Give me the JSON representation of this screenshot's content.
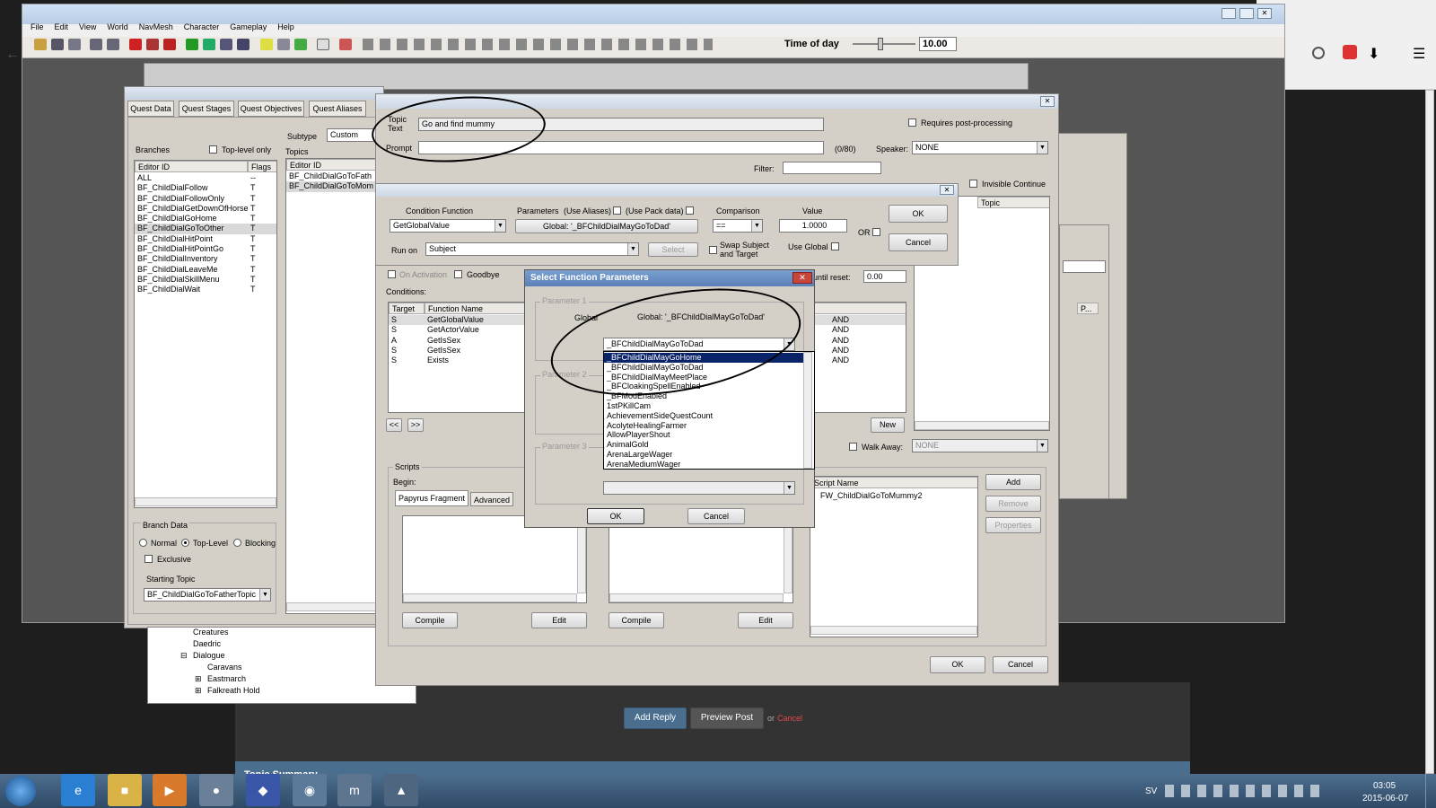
{
  "editor": {
    "menu": [
      "File",
      "Edit",
      "View",
      "World",
      "NavMesh",
      "Character",
      "Gameplay",
      "Help"
    ],
    "time_of_day_label": "Time of day",
    "time_of_day_value": "10.00"
  },
  "quest_window": {
    "tabs": [
      "Quest Data",
      "Quest Stages",
      "Quest Objectives",
      "Quest Aliases"
    ],
    "subtype_label": "Subtype",
    "subtype_value": "Custom",
    "branches_label": "Branches",
    "top_level_only_label": "Top-level only",
    "topics_label": "Topics",
    "branch_col_editor": "Editor ID",
    "branch_col_flags": "Flags",
    "branches": [
      {
        "id": "ALL",
        "flag": "--"
      },
      {
        "id": "BF_ChildDialFollow",
        "flag": "T"
      },
      {
        "id": "BF_ChildDialFollowOnly",
        "flag": "T"
      },
      {
        "id": "BF_ChildDialGetDownOfHorse",
        "flag": "T"
      },
      {
        "id": "BF_ChildDialGoHome",
        "flag": "T"
      },
      {
        "id": "BF_ChildDialGoToOther",
        "flag": "T"
      },
      {
        "id": "BF_ChildDialHitPoint",
        "flag": "T"
      },
      {
        "id": "BF_ChildDialHitPointGo",
        "flag": "T"
      },
      {
        "id": "BF_ChildDialInventory",
        "flag": "T"
      },
      {
        "id": "BF_ChildDialLeaveMe",
        "flag": "T"
      },
      {
        "id": "BF_ChildDialSkillMenu",
        "flag": "T"
      },
      {
        "id": "BF_ChildDialWait",
        "flag": "T"
      }
    ],
    "topics_col_editor": "Editor ID",
    "topics": [
      "BF_ChildDialGoToFath",
      "BF_ChildDialGoToMom"
    ],
    "branch_data_label": "Branch Data",
    "radio_normal": "Normal",
    "radio_top_level": "Top-Level",
    "radio_blocking": "Blocking",
    "exclusive_label": "Exclusive",
    "starting_topic_label": "Starting Topic",
    "starting_topic_value": "BF_ChildDialGoToFatherTopic"
  },
  "object_tree": [
    "Creatures",
    "Daedric",
    "Dialogue",
    "Caravans",
    "Eastmarch",
    "Falkreath Hold"
  ],
  "topic_info": {
    "topic_text_label": "Topic\nText",
    "topic_text_value": "Go and find mummy",
    "requires_post_label": "Requires post-processing",
    "prompt_label": "Prompt",
    "prompt_count": "(0/80)",
    "speaker_label": "Speaker:",
    "speaker_value": "NONE",
    "filter_label": "Filter:",
    "invisible_continue_label": "Invisible Continue",
    "topic_col": "Topic",
    "on_activation_label": "On Activation",
    "goodbye_label": "Goodbye",
    "until_reset_label": "until reset:",
    "until_reset_value": "0.00",
    "conditions_label": "Conditions:",
    "cond_col_target": "Target",
    "cond_col_function": "Function Name",
    "conditions": [
      {
        "target": "S",
        "func": "GetGlobalValue",
        "op": "AND"
      },
      {
        "target": "S",
        "func": "GetActorValue",
        "op": "AND"
      },
      {
        "target": "A",
        "func": "GetIsSex",
        "op": "AND"
      },
      {
        "target": "S",
        "func": "GetIsSex",
        "op": "AND"
      },
      {
        "target": "S",
        "func": "Exists",
        "op": "AND"
      }
    ],
    "prev_btn": "<<",
    "next_btn": ">>",
    "new_btn": "New",
    "walk_away_label": "Walk Away:",
    "walk_away_value": "NONE",
    "scripts_label": "Scripts",
    "begin_label": "Begin:",
    "papyrus_tab": "Papyrus Fragment",
    "advanced_tab": "Advanced",
    "compile_btn": "Compile",
    "edit_btn": "Edit",
    "script_name_col": "Script Name",
    "script_name": "FW_ChildDialGoToMummy2",
    "add_btn": "Add",
    "remove_btn": "Remove",
    "properties_btn": "Properties",
    "ok_btn": "OK",
    "cancel_btn": "Cancel",
    "p_col": "P..."
  },
  "condition_dialog": {
    "condition_function_label": "Condition Function",
    "function_value": "GetGlobalValue",
    "parameters_label": "Parameters",
    "use_aliases_label": "(Use Aliases)",
    "use_pack_label": "(Use Pack data)",
    "global_param": "Global: '_BFChildDialMayGoToDad'",
    "comparison_label": "Comparison",
    "comparison_value": "==",
    "value_label": "Value",
    "value_value": "1.0000",
    "or_label": "OR",
    "run_on_label": "Run on",
    "run_on_value": "Subject",
    "select_btn": "Select",
    "swap_label": "Swap Subject\nand Target",
    "use_global_label": "Use Global",
    "ok_btn": "OK",
    "cancel_btn": "Cancel"
  },
  "select_params": {
    "title": "Select Function Parameters",
    "group1": "Parameter 1",
    "group2": "Parameter 2",
    "group3": "Parameter 3",
    "global_label": "Global",
    "global_current": "Global: '_BFChildDialMayGoToDad'",
    "combo_value": "_BFChildDialMayGoToDad",
    "options": [
      "_BFChildDialMayGoHome",
      "_BFChildDialMayGoToDad",
      "_BFChildDialMayMeetPlace",
      "_BFCloakingSpellEnabled",
      "_BFModEnabled",
      "1stPKillCam",
      "AchievementSideQuestCount",
      "AcolyteHealingFarmer",
      "AllowPlayerShout",
      "AnimalGold",
      "ArenaLargeWager",
      "ArenaMediumWager"
    ],
    "selected_index": 0,
    "ok_btn": "OK",
    "cancel_btn": "Cancel"
  },
  "forum": {
    "add_reply": "Add Reply",
    "preview_post": "Preview Post",
    "or_text": "or",
    "cancel_link": "Cancel",
    "topic_summary": "Topic Summary"
  },
  "taskbar": {
    "sv": "SV",
    "time": "03:05",
    "date": "2015-06-07"
  }
}
